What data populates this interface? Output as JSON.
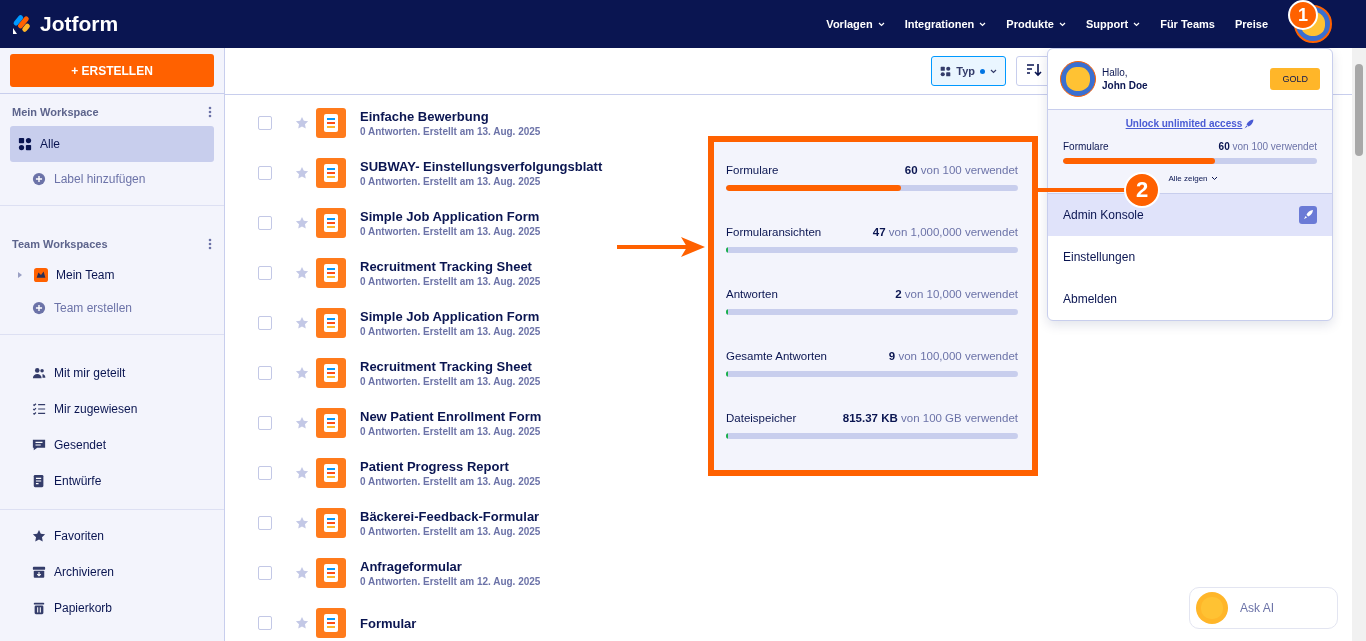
{
  "header": {
    "logo": "Jotform",
    "nav": [
      {
        "label": "Vorlagen",
        "has_menu": true
      },
      {
        "label": "Integrationen",
        "has_menu": true
      },
      {
        "label": "Produkte",
        "has_menu": true
      },
      {
        "label": "Support",
        "has_menu": true
      },
      {
        "label": "Für Teams",
        "has_menu": false
      },
      {
        "label": "Preise",
        "has_menu": false
      }
    ]
  },
  "sidebar": {
    "create_button": "+ ERSTELLEN",
    "sections": [
      {
        "title": "Mein Workspace",
        "items": [
          {
            "label": "Alle",
            "kind": "nav",
            "selected": true
          },
          {
            "label": "Label hinzufügen",
            "kind": "add",
            "selected": false
          }
        ]
      },
      {
        "title": "Team Workspaces",
        "items": [
          {
            "label": "Mein Team",
            "kind": "team",
            "selected": false
          },
          {
            "label": "Team erstellen",
            "kind": "add",
            "selected": false
          }
        ]
      },
      {
        "items": [
          {
            "label": "Mit mir geteilt",
            "kind": "nav",
            "selected": false
          },
          {
            "label": "Mir zugewiesen",
            "kind": "nav",
            "selected": false
          },
          {
            "label": "Gesendet",
            "kind": "nav",
            "selected": false
          },
          {
            "label": "Entwürfe",
            "kind": "nav",
            "selected": false
          }
        ]
      },
      {
        "items": [
          {
            "label": "Favoriten",
            "kind": "nav",
            "selected": false
          },
          {
            "label": "Archivieren",
            "kind": "nav",
            "selected": false
          },
          {
            "label": "Papierkorb",
            "kind": "nav",
            "selected": false
          }
        ]
      }
    ]
  },
  "toolbar": {
    "type_filter": {
      "label": "Typ",
      "active": true
    }
  },
  "forms": [
    {
      "title": "Einfache Bewerbung",
      "checked": false,
      "meta": "0 Antworten. Erstellt am 13. Aug. 2025"
    },
    {
      "title": "SUBWAY- Einstellungsverfolgungsblatt",
      "checked": false,
      "meta": "0 Antworten. Erstellt am 13. Aug. 2025"
    },
    {
      "title": "Simple Job Application Form",
      "checked": false,
      "meta": "0 Antworten. Erstellt am 13. Aug. 2025"
    },
    {
      "title": "Recruitment Tracking Sheet",
      "checked": false,
      "meta": "0 Antworten. Erstellt am 13. Aug. 2025"
    },
    {
      "title": "Simple Job Application Form",
      "checked": false,
      "meta": "0 Antworten. Erstellt am 13. Aug. 2025"
    },
    {
      "title": "Recruitment Tracking Sheet",
      "checked": false,
      "meta": "0 Antworten. Erstellt am 13. Aug. 2025"
    },
    {
      "title": "New Patient Enrollment Form",
      "checked": false,
      "meta": "0 Antworten. Erstellt am 13. Aug. 2025"
    },
    {
      "title": "Patient Progress Report",
      "checked": false,
      "meta": "0 Antworten. Erstellt am 13. Aug. 2025"
    },
    {
      "title": "Bäckerei-Feedback-Formular",
      "checked": false,
      "meta": "0 Antworten. Erstellt am 13. Aug. 2025"
    },
    {
      "title": "Anfrageformular",
      "checked": false,
      "meta": "0 Antworten. Erstellt am 12. Aug. 2025"
    },
    {
      "title": "Formular",
      "checked": false
    }
  ],
  "account_menu": {
    "greeting": "Hallo,",
    "name": "John Doe",
    "plan": "GOLD",
    "upgrade_link": "Unlock unlimited access",
    "usage": {
      "label": "Formulare",
      "used": "60",
      "total": "von 100 verwendet",
      "level": 0.6
    },
    "show_all": "Alle zeigen",
    "items": [
      {
        "label": "Admin Konsole",
        "selected": true
      },
      {
        "label": "Einstellungen",
        "selected": false
      },
      {
        "label": "Abmelden",
        "selected": false
      }
    ]
  },
  "callout": {
    "usage": [
      {
        "label": "Formulare",
        "used": "60",
        "total": "von 100 verwendet",
        "level": 0.6,
        "color": "#ff6100"
      },
      {
        "label": "Formularansichten",
        "used": "47",
        "total": "von 1,000,000 verwendet",
        "level": 0.005,
        "color": "#18b04a"
      },
      {
        "label": "Antworten",
        "used": "2",
        "total": "von 10,000 verwendet",
        "level": 0.005,
        "color": "#18b04a"
      },
      {
        "label": "Gesamte Antworten",
        "used": "9",
        "total": "von 100,000 verwendet",
        "level": 0.005,
        "color": "#18b04a"
      },
      {
        "label": "Dateispeicher",
        "used": "815.37 KB",
        "total": "von 100 GB verwendet",
        "level": 0.005,
        "color": "#18b04a"
      }
    ]
  },
  "markers": [
    "1",
    "2"
  ],
  "ask_ai": "Ask AI"
}
